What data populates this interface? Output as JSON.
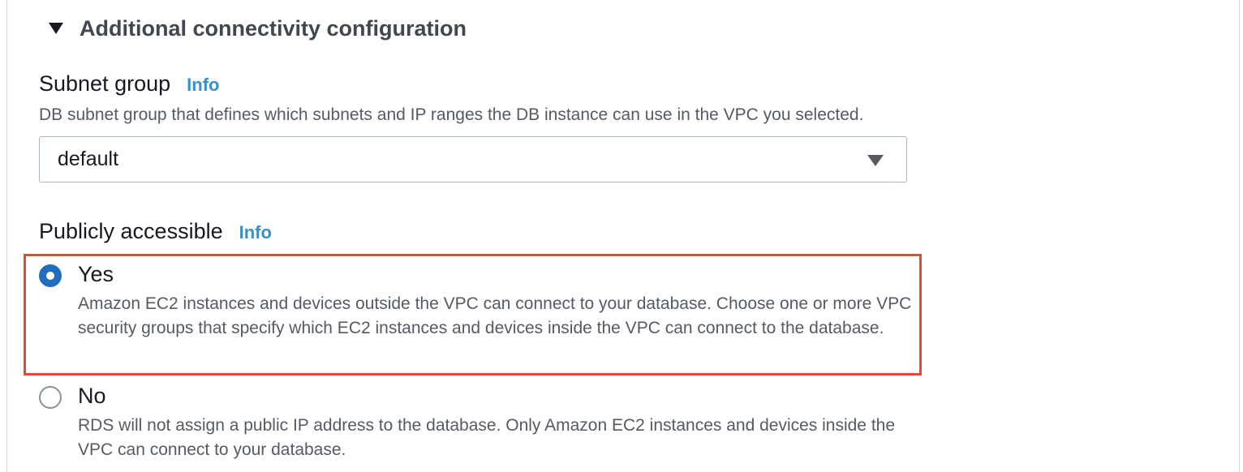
{
  "section": {
    "title": "Additional connectivity configuration"
  },
  "subnet_group": {
    "label": "Subnet group",
    "info": "Info",
    "description": "DB subnet group that defines which subnets and IP ranges the DB instance can use in the VPC you selected.",
    "selected": "default"
  },
  "public_access": {
    "label": "Publicly accessible",
    "info": "Info",
    "options": [
      {
        "title": "Yes",
        "description": "Amazon EC2 instances and devices outside the VPC can connect to your database. Choose one or more VPC security groups that specify which EC2 instances and devices inside the VPC can connect to the database.",
        "selected": true
      },
      {
        "title": "No",
        "description": "RDS will not assign a public IP address to the database. Only Amazon EC2 instances and devices inside the VPC can connect to your database.",
        "selected": false
      }
    ]
  },
  "colors": {
    "accent": "#1f6ebd",
    "info_link": "#3b8fc4",
    "highlight_border": "#e04b31"
  }
}
